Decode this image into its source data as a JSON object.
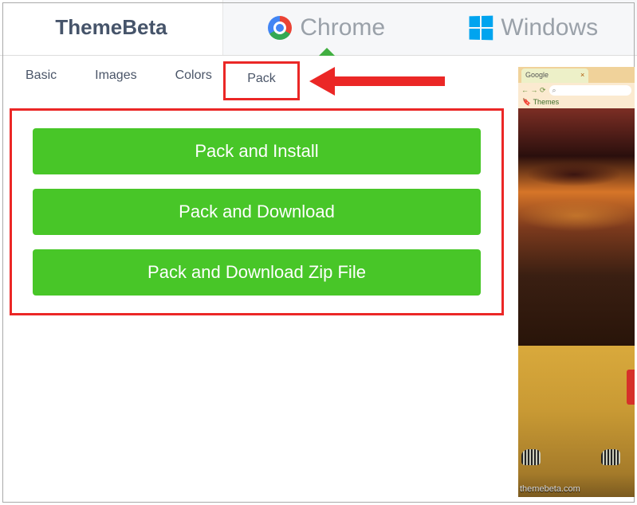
{
  "brand": "ThemeBeta",
  "nav": {
    "chrome": "Chrome",
    "windows": "Windows"
  },
  "tabs": {
    "basic": "Basic",
    "images": "Images",
    "colors": "Colors",
    "pack": "Pack"
  },
  "buttons": {
    "install": "Pack and Install",
    "download": "Pack and Download",
    "zip": "Pack and Download Zip File"
  },
  "preview": {
    "tab_label": "Google",
    "bookmark": "Themes",
    "tool_icons": "← → ⟳",
    "search_icon": "⌕",
    "footer": "themebeta.com"
  }
}
